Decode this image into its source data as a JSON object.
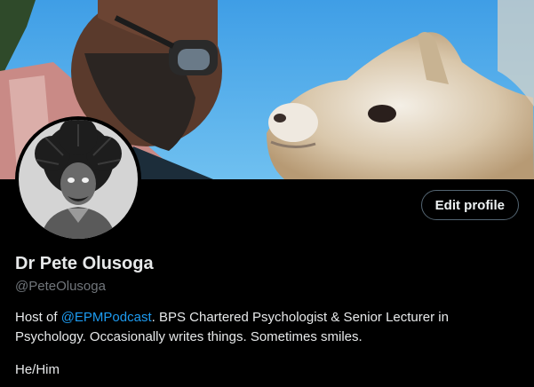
{
  "profile": {
    "name": "Dr Pete Olusoga",
    "handle": "@PeteOlusoga",
    "edit_label": "Edit profile",
    "bio": {
      "prefix": "Host of ",
      "mention": "@EPMPodcast",
      "suffix": ". BPS Chartered Psychologist & Senior Lecturer in Psychology. Occasionally writes things. Sometimes smiles."
    },
    "pronouns": "He/Him"
  },
  "colors": {
    "background": "#000000",
    "text_primary": "#e7e9ea",
    "text_secondary": "#71767b",
    "link": "#1d9bf0",
    "button_border": "#536471"
  }
}
